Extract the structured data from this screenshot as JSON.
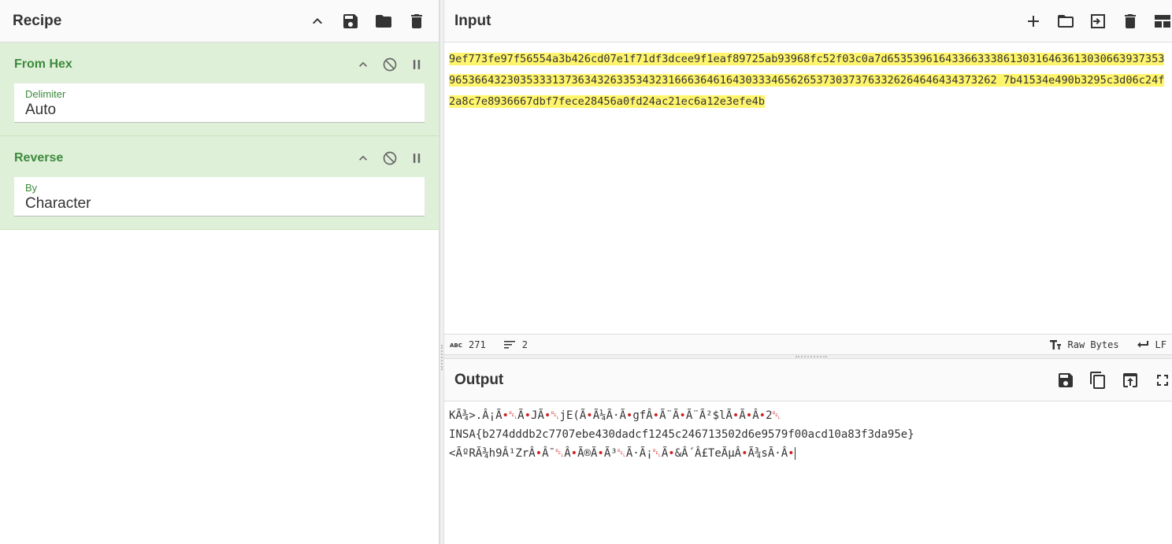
{
  "recipe": {
    "title": "Recipe",
    "operations": [
      {
        "name": "From Hex",
        "arg_label": "Delimiter",
        "arg_value": "Auto"
      },
      {
        "name": "Reverse",
        "arg_label": "By",
        "arg_value": "Character"
      }
    ]
  },
  "input": {
    "title": "Input",
    "text": "9ef773fe97f56554a3b426cd07e1f71df3dcee9f1eaf89725ab93968fc52f03c0a7d65353961643366333861303164636130306639373539653664323035333137363432633534323166636461643033346562653730373763326264646434373262 7b41534e490b3295c3d06c24f2a8c7e8936667dbf7fece28456a0fd24ac21ec6a12e3efe4b",
    "status": {
      "char_count": "271",
      "line_count": "2",
      "format_label": "Raw Bytes",
      "eol_label": "LF"
    }
  },
  "output": {
    "title": "Output",
    "line1": "KÃ¾>.Â¡Ã•␇Ã•JÃ•␇jE(Ã•Ã¼Ã·Ã•gfÂ•Ã¨Ã•Ã¨Ã²$lÃ•Ã•Â•2␇",
    "line2": "INSA{b274dddb2c7707ebe430dadcf1245c246713502d6e9579f00acd10a83f3da95e}",
    "line3": "<ÃºRÃ¾h9Â¹ZrÂ•Â¯␇Â•Ã®Ã•Ã³␇Ã·Ã¡␇Ã•&Â´Â£TeÃµÂ•Ã¾sÃ·Â•"
  }
}
